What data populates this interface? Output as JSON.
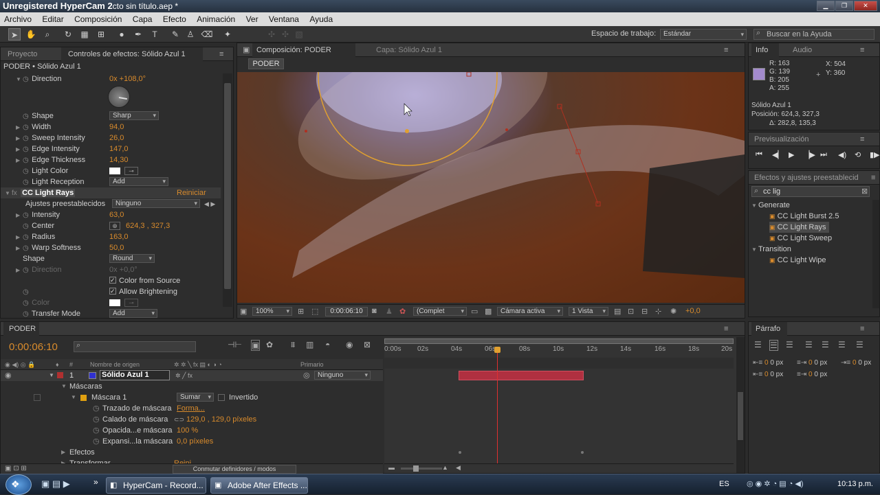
{
  "titlebar": {
    "watermark": "Unregistered HyperCam 2",
    "title": "cto sin título.aep *"
  },
  "menu": [
    "Archivo",
    "Editar",
    "Composición",
    "Capa",
    "Efecto",
    "Animación",
    "Ver",
    "Ventana",
    "Ayuda"
  ],
  "toolbar": {
    "workspace_label": "Espacio de trabajo:",
    "workspace_value": "Estándar",
    "help_placeholder": "Buscar en la Ayuda"
  },
  "left_panel": {
    "tab_project": "Proyecto",
    "tab_effects": "Controles de efectos: Sólido Azul 1",
    "breadcrumb": "PODER • Sólido Azul 1",
    "props": [
      {
        "name": "Direction",
        "value": "0x +108,0°"
      },
      {
        "name": "Shape",
        "value": "Sharp"
      },
      {
        "name": "Width",
        "value": "94,0"
      },
      {
        "name": "Sweep Intensity",
        "value": "26,0"
      },
      {
        "name": "Edge Intensity",
        "value": "147,0"
      },
      {
        "name": "Edge Thickness",
        "value": "14,30"
      },
      {
        "name": "Light Color",
        "value": ""
      },
      {
        "name": "Light Reception",
        "value": "Add"
      },
      {
        "name": "CC Light Rays",
        "value": "Reiniciar"
      },
      {
        "name": "Ajustes preestablecidos",
        "value": "Ninguno"
      },
      {
        "name": "Intensity",
        "value": "63,0"
      },
      {
        "name": "Center",
        "value": "624,3 , 327,3"
      },
      {
        "name": "Radius",
        "value": "163,0"
      },
      {
        "name": "Warp Softness",
        "value": "50,0"
      },
      {
        "name": "Shape",
        "value": "Round"
      },
      {
        "name": "Direction",
        "value": "0x +0,0°"
      },
      {
        "name": "Color from Source",
        "value": ""
      },
      {
        "name": "Allow Brightening",
        "value": ""
      },
      {
        "name": "Color",
        "value": ""
      },
      {
        "name": "Transfer Mode",
        "value": "Add"
      }
    ]
  },
  "comp": {
    "tab_comp": "Composición: PODER",
    "tab_layer": "Capa: Sólido Azul 1",
    "comp_name": "PODER",
    "zoom": "100%",
    "timecode": "0:00:06:10",
    "quality": "(Complet",
    "camera": "Cámara activa",
    "views": "1 Vista",
    "exposure": "+0,0"
  },
  "info": {
    "tab_info": "Info",
    "tab_audio": "Audio",
    "r": "R:  163",
    "g": "G:  139",
    "b": "B:  205",
    "a": "A:  255",
    "x": "X:  504",
    "y": "Y:  360",
    "layer": "Sólido Azul 1",
    "position": "Posición: 624,3, 327,3",
    "delta": "Δ: 282,8, 135,3",
    "swatch": "#a38bcd"
  },
  "preview": {
    "title": "Previsualización"
  },
  "effects_presets": {
    "title": "Efectos y ajustes preestablecid",
    "search": "cc lig",
    "groups": [
      {
        "name": "Generate",
        "items": [
          "CC Light Burst 2.5",
          "CC Light Rays",
          "CC Light Sweep"
        ]
      },
      {
        "name": "Transition",
        "items": [
          "CC Light Wipe"
        ]
      }
    ]
  },
  "timeline": {
    "tab": "PODER",
    "timecode": "0:00:06:10",
    "col_source": "Nombre de origen",
    "col_parent": "Primario",
    "layer_index": "1",
    "layer_name": "Sólido Azul 1",
    "parent_value": "Ninguno",
    "rows": [
      {
        "label": "Máscaras",
        "value": ""
      },
      {
        "label": "Máscara 1",
        "value": ""
      },
      {
        "label": "Trazado de máscara",
        "value": "Forma..."
      },
      {
        "label": "Calado de máscara",
        "value": "129,0 , 129,0  píxeles"
      },
      {
        "label": "Opacida...e máscara",
        "value": "100 %"
      },
      {
        "label": "Expansi...la máscara",
        "value": "0,0  píxeles"
      },
      {
        "label": "Efectos",
        "value": ""
      },
      {
        "label": "Transformar",
        "value": "Reini"
      }
    ],
    "mask_mode": "Sumar",
    "inverted_label": "Invertido",
    "footer": "Conmutar definidores / modos",
    "ticks": [
      "0:00s",
      "02s",
      "04s",
      "06s",
      "08s",
      "10s",
      "12s",
      "14s",
      "16s",
      "18s",
      "20s"
    ]
  },
  "paragraph": {
    "title": "Párrafo",
    "px1": "0 px",
    "px2": "0 px",
    "px3": "0 px",
    "px4": "0 px",
    "px5": "0 px"
  },
  "taskbar": {
    "task1": "HyperCam - Record...",
    "task2": "Adobe After Effects ...",
    "lang": "ES",
    "clock": "10:13 p.m."
  }
}
